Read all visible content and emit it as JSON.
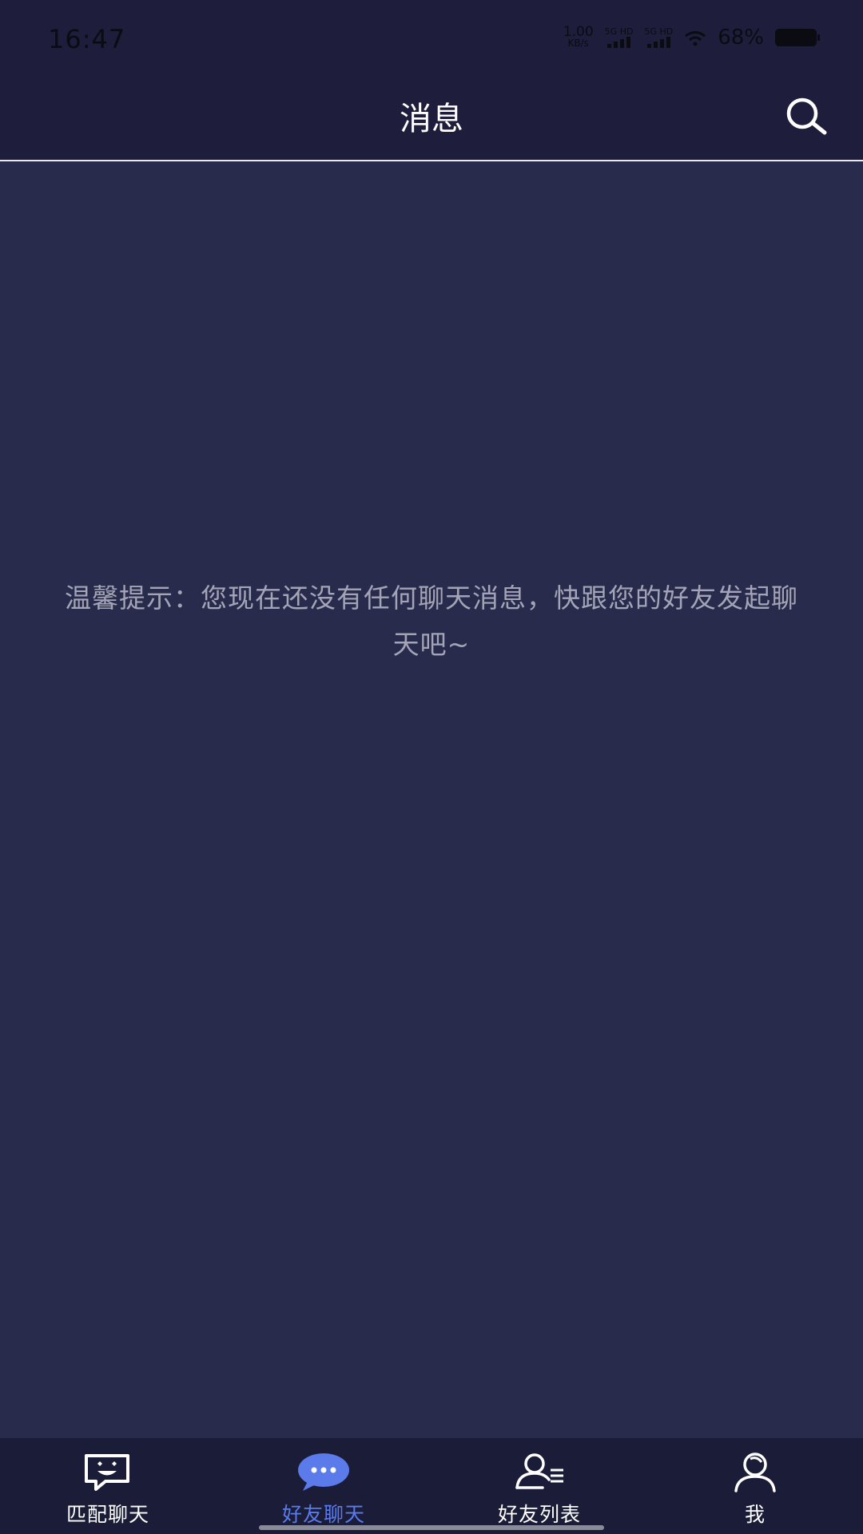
{
  "status_bar": {
    "time": "16:47",
    "net_speed_value": "1.00",
    "net_speed_unit": "KB/s",
    "sim1_label": "5G HD",
    "sim2_label": "5G HD",
    "battery_percent": "68%"
  },
  "header": {
    "title": "消息"
  },
  "main": {
    "empty_tip": "温馨提示：您现在还没有任何聊天消息，快跟您的好友发起聊天吧~"
  },
  "bottom_nav": {
    "active_color": "#5b7bea",
    "items": [
      {
        "label": "匹配聊天",
        "icon": "match-chat-icon",
        "active": false
      },
      {
        "label": "好友聊天",
        "icon": "friend-chat-icon",
        "active": true
      },
      {
        "label": "好友列表",
        "icon": "friend-list-icon",
        "active": false
      },
      {
        "label": "我",
        "icon": "profile-icon",
        "active": false
      }
    ]
  }
}
